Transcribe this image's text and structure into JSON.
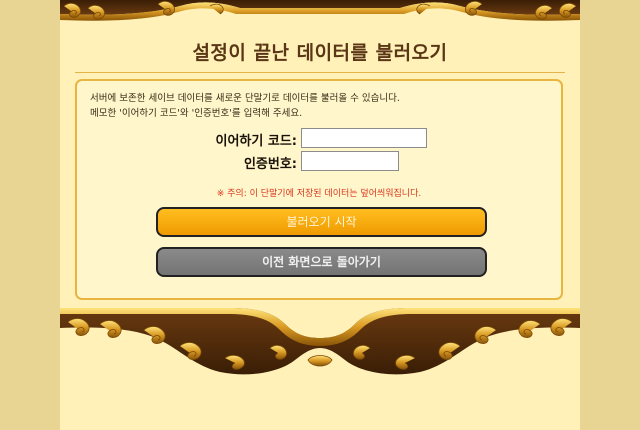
{
  "page": {
    "title": "설정이 끝난 데이터를 불러오기"
  },
  "panel": {
    "description_line1": "서버에 보존한 세이브 데이터를 새로운 단말기로 데이터를 불러올 수 있습니다.",
    "description_line2": "메모한 '이어하기 코드'와 '인증번호'를 입력해 주세요.",
    "continue_code_label": "이어하기 코드:",
    "continue_code_value": "",
    "auth_number_label": "인증번호:",
    "auth_number_value": "",
    "warning": "※ 주의: 이 단말기에 저장된 데이터는 덮어씌워집니다."
  },
  "buttons": {
    "load_label": "불러오기 시작",
    "back_label": "이전 화면으로 돌아가기"
  },
  "colors": {
    "background": "#e8d594",
    "frame": "#fff1b8",
    "ornament_gold": "#c88a1c",
    "panel_border": "#e7b540",
    "title": "#5a3616",
    "warning": "#d8361d",
    "load_button": "#f5a800",
    "back_button": "#7e7e7e"
  },
  "icons": {
    "top_ornament": "gold-scroll-ornament",
    "bottom_ornament": "gold-scroll-ornament"
  }
}
